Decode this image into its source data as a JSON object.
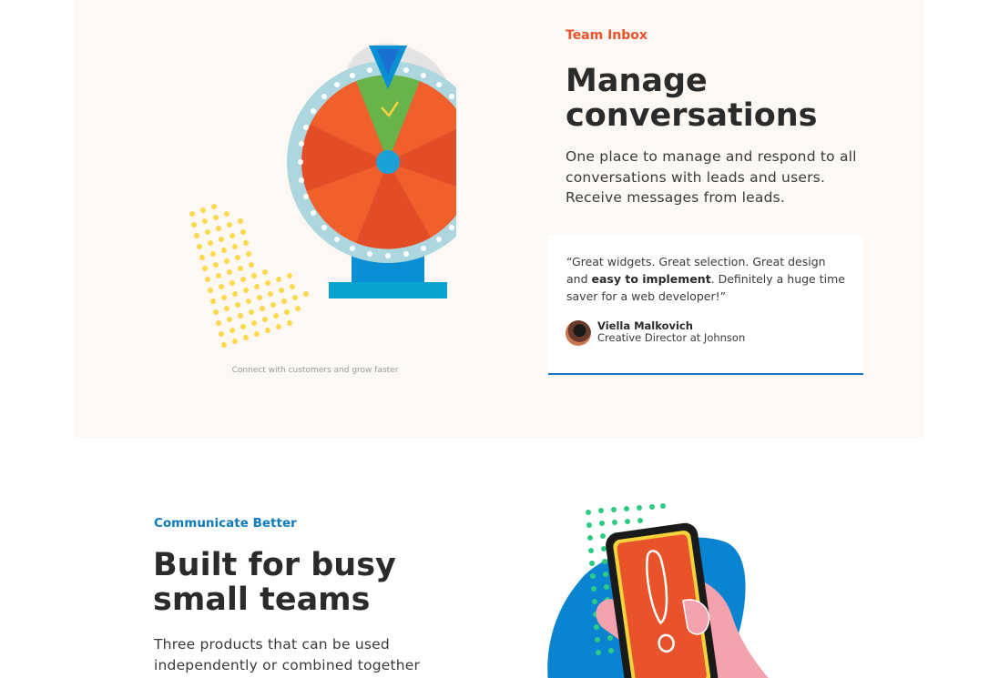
{
  "team_inbox": {
    "eyebrow": "Team Inbox",
    "title_line1": "Manage",
    "title_line2": "conversations",
    "description": "One place to manage and respond to all conversations with leads and users. Receive messages from leads.",
    "illustration_caption": "Connect with customers and grow faster",
    "illustration_icon": "prize-wheel-icon",
    "testimonial": {
      "quote_before": "“Great widgets. Great selection. Great design and ",
      "quote_bold": "easy to implement",
      "quote_after": ". Definitely a huge time saver for a web developer!”",
      "author_name": "Viella Malkovich",
      "author_role": "Creative Director at Johnson"
    }
  },
  "communicate": {
    "eyebrow": "Communicate Better",
    "title_line1": "Built for busy",
    "title_line2": "small teams",
    "description": "Three products that can be used independently or combined together",
    "illustration_icon": "phone-alert-icon"
  },
  "colors": {
    "accent_orange": "#e8532b",
    "accent_blue": "#0f7bbd",
    "section_bg": "#fdf8f4",
    "card_border": "#1873c4"
  }
}
